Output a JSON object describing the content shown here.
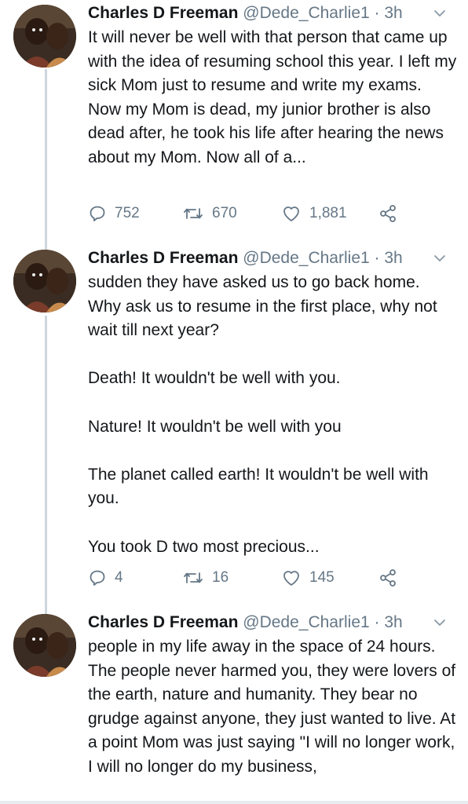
{
  "tweets": [
    {
      "name": "Charles D Freeman",
      "handle": "@Dede_Charlie1",
      "separator": "·",
      "time": "3h",
      "paragraphs": [
        "It will never be well with that person that came up with the idea of resuming school this year. I left my sick Mom just to resume and write my exams. Now my Mom is dead, my junior brother is also dead after, he took his life after hearing the news about my Mom. Now all of a..."
      ],
      "replies": "752",
      "retweets": "670",
      "likes": "1,881"
    },
    {
      "name": "Charles D Freeman",
      "handle": "@Dede_Charlie1",
      "separator": "·",
      "time": "3h",
      "paragraphs": [
        "sudden they have asked us to go back home. Why ask us to resume in the first place, why not wait till next year?",
        "Death! It wouldn't be well with you.",
        "Nature! It wouldn't be well with you",
        "The planet called earth! It wouldn't be well with you.",
        "You took D two most precious..."
      ],
      "replies": "4",
      "retweets": "16",
      "likes": "145"
    },
    {
      "name": "Charles D Freeman",
      "handle": "@Dede_Charlie1",
      "separator": "·",
      "time": "3h",
      "paragraphs": [
        "people in my life away in the space of 24 hours. The people never harmed you, they were lovers of the earth, nature and humanity. They bear no grudge against anyone, they just wanted to live. At a point Mom was just saying \"I will no longer work, I will no longer do my business,"
      ]
    }
  ],
  "icons": {
    "reply": "reply-icon",
    "retweet": "retweet-icon",
    "like": "heart-icon",
    "share": "share-icon",
    "menu": "chevron-down-icon"
  },
  "colors": {
    "text": "#14171a",
    "secondary": "#657786",
    "thread_line": "#ccd6dd"
  }
}
